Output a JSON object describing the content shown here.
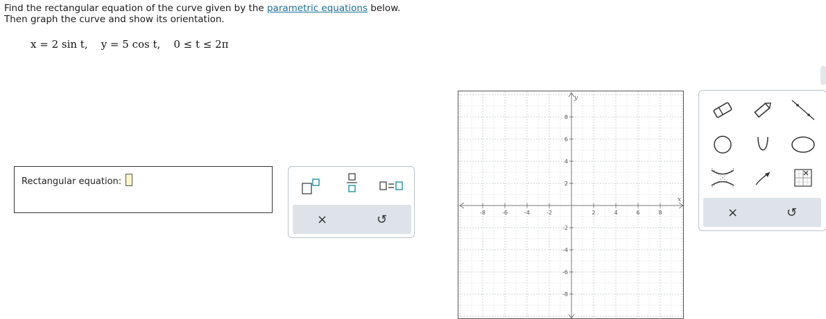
{
  "prompt": {
    "line1_before": "Find the rectangular equation of the curve given by the ",
    "link": "parametric equations",
    "line1_after": " below.",
    "line2": "Then graph the curve and show its orientation."
  },
  "equation": {
    "x": "x = 2 sin t,",
    "y": "y = 5 cos t,",
    "domain": "0 ≤ t ≤ 2π"
  },
  "answer": {
    "label": "Rectangular equation:",
    "value": ""
  },
  "math_palette": {
    "buttons": [
      "superscript-template",
      "fraction-template",
      "equation-template"
    ],
    "clear_label": "×",
    "reset_label": "↺"
  },
  "graph": {
    "x_label": "x",
    "y_label": "y",
    "x_ticks": [
      "-8",
      "-6",
      "-4",
      "-2",
      "2",
      "4",
      "6",
      "8"
    ],
    "y_ticks": [
      "8",
      "6",
      "4",
      "2",
      "-2",
      "-4",
      "-6",
      "-8"
    ]
  },
  "graph_tools": {
    "tools": [
      "eraser-icon",
      "pencil-icon",
      "line-segment-icon",
      "circle-icon",
      "parabola-icon",
      "ellipse-icon",
      "hyperbola-icon",
      "orientation-arrow-icon",
      "no-solution-icon"
    ],
    "clear_label": "×",
    "reset_label": "↺"
  },
  "colors": {
    "link": "#1a6e9c",
    "input_bg": "#fdf5c9",
    "palette_border": "#b9c4cc",
    "toolbar_bg": "#dde3e8",
    "teal": "#1b8ea8"
  }
}
